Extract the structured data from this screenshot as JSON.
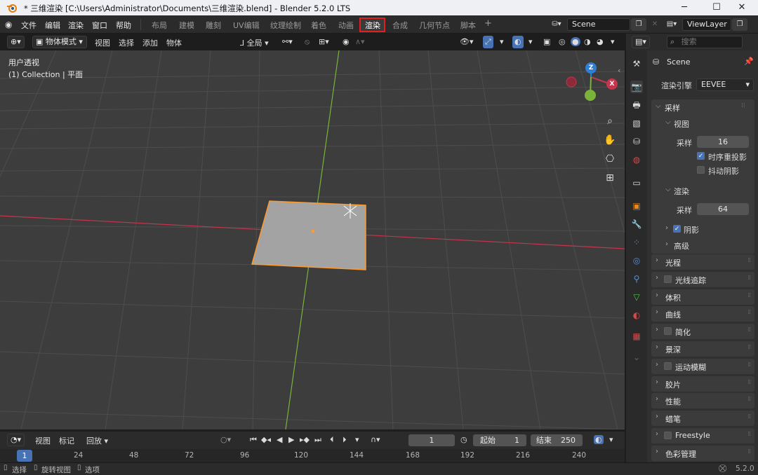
{
  "window": {
    "title": "* 三维渲染 [C:\\Users\\Administrator\\Documents\\三维渲染.blend] - Blender 5.2.0 LTS",
    "minimize": "─",
    "maximize": "☐",
    "close": "✕"
  },
  "menu": [
    "文件",
    "编辑",
    "渲染",
    "窗口",
    "帮助"
  ],
  "workspaces": [
    "布局",
    "建模",
    "雕刻",
    "UV编辑",
    "纹理绘制",
    "着色",
    "动画",
    "渲染",
    "合成",
    "几何节点",
    "脚本"
  ],
  "workspace_add": "+",
  "scene_name": "Scene",
  "view_layer": "ViewLayer",
  "viewport_header": {
    "mode": "物体模式",
    "menus": [
      "视图",
      "选择",
      "添加",
      "物体"
    ],
    "transform": "全局"
  },
  "viewport": {
    "perspective_label": "用户透视",
    "collection_label": "(1) Collection | 平面",
    "axes": {
      "z": "Z",
      "x": "X"
    }
  },
  "props": {
    "search_placeholder": "搜索",
    "scene": "Scene",
    "render_engine_label": "渲染引擎",
    "render_engine": "EEVEE",
    "sampling": {
      "title": "采样",
      "viewport_title": "视图",
      "viewport_samples_label": "采样",
      "viewport_samples": "16",
      "temporal_reprojection": "时序重投影",
      "jittered_shadows": "抖动阴影",
      "render_title": "渲染",
      "render_samples_label": "采样",
      "render_samples": "64",
      "shadows": "阴影",
      "advanced": "高级"
    },
    "panels": [
      {
        "label": "光程",
        "checkbox": false
      },
      {
        "label": "光线追踪",
        "checkbox": true
      },
      {
        "label": "体积",
        "checkbox": false
      },
      {
        "label": "曲线",
        "checkbox": false
      },
      {
        "label": "简化",
        "checkbox": true
      },
      {
        "label": "景深",
        "checkbox": false
      },
      {
        "label": "运动模糊",
        "checkbox": true
      },
      {
        "label": "胶片",
        "checkbox": false
      },
      {
        "label": "性能",
        "checkbox": false
      },
      {
        "label": "蜡笔",
        "checkbox": false
      },
      {
        "label": "Freestyle",
        "checkbox": true
      },
      {
        "label": "色彩管理",
        "checkbox": false
      }
    ]
  },
  "timeline": {
    "menus": [
      "视图",
      "标记",
      "回放"
    ],
    "current_frame": "1",
    "start_label": "起始",
    "start": "1",
    "end_label": "结束",
    "end": "250"
  },
  "ruler_ticks": [
    "1",
    "24",
    "48",
    "72",
    "96",
    "120",
    "144",
    "168",
    "192",
    "216",
    "240"
  ],
  "status": {
    "select": "选择",
    "rotate": "旋转视图",
    "options": "选项",
    "version": "5.2.0"
  },
  "colors": {
    "accent": "#4772b3",
    "highlight": "#e02020",
    "x_axis": "#c5354d",
    "y_axis": "#7ab33a",
    "z_axis": "#2f7fd6",
    "selection": "#ff9a2e"
  }
}
